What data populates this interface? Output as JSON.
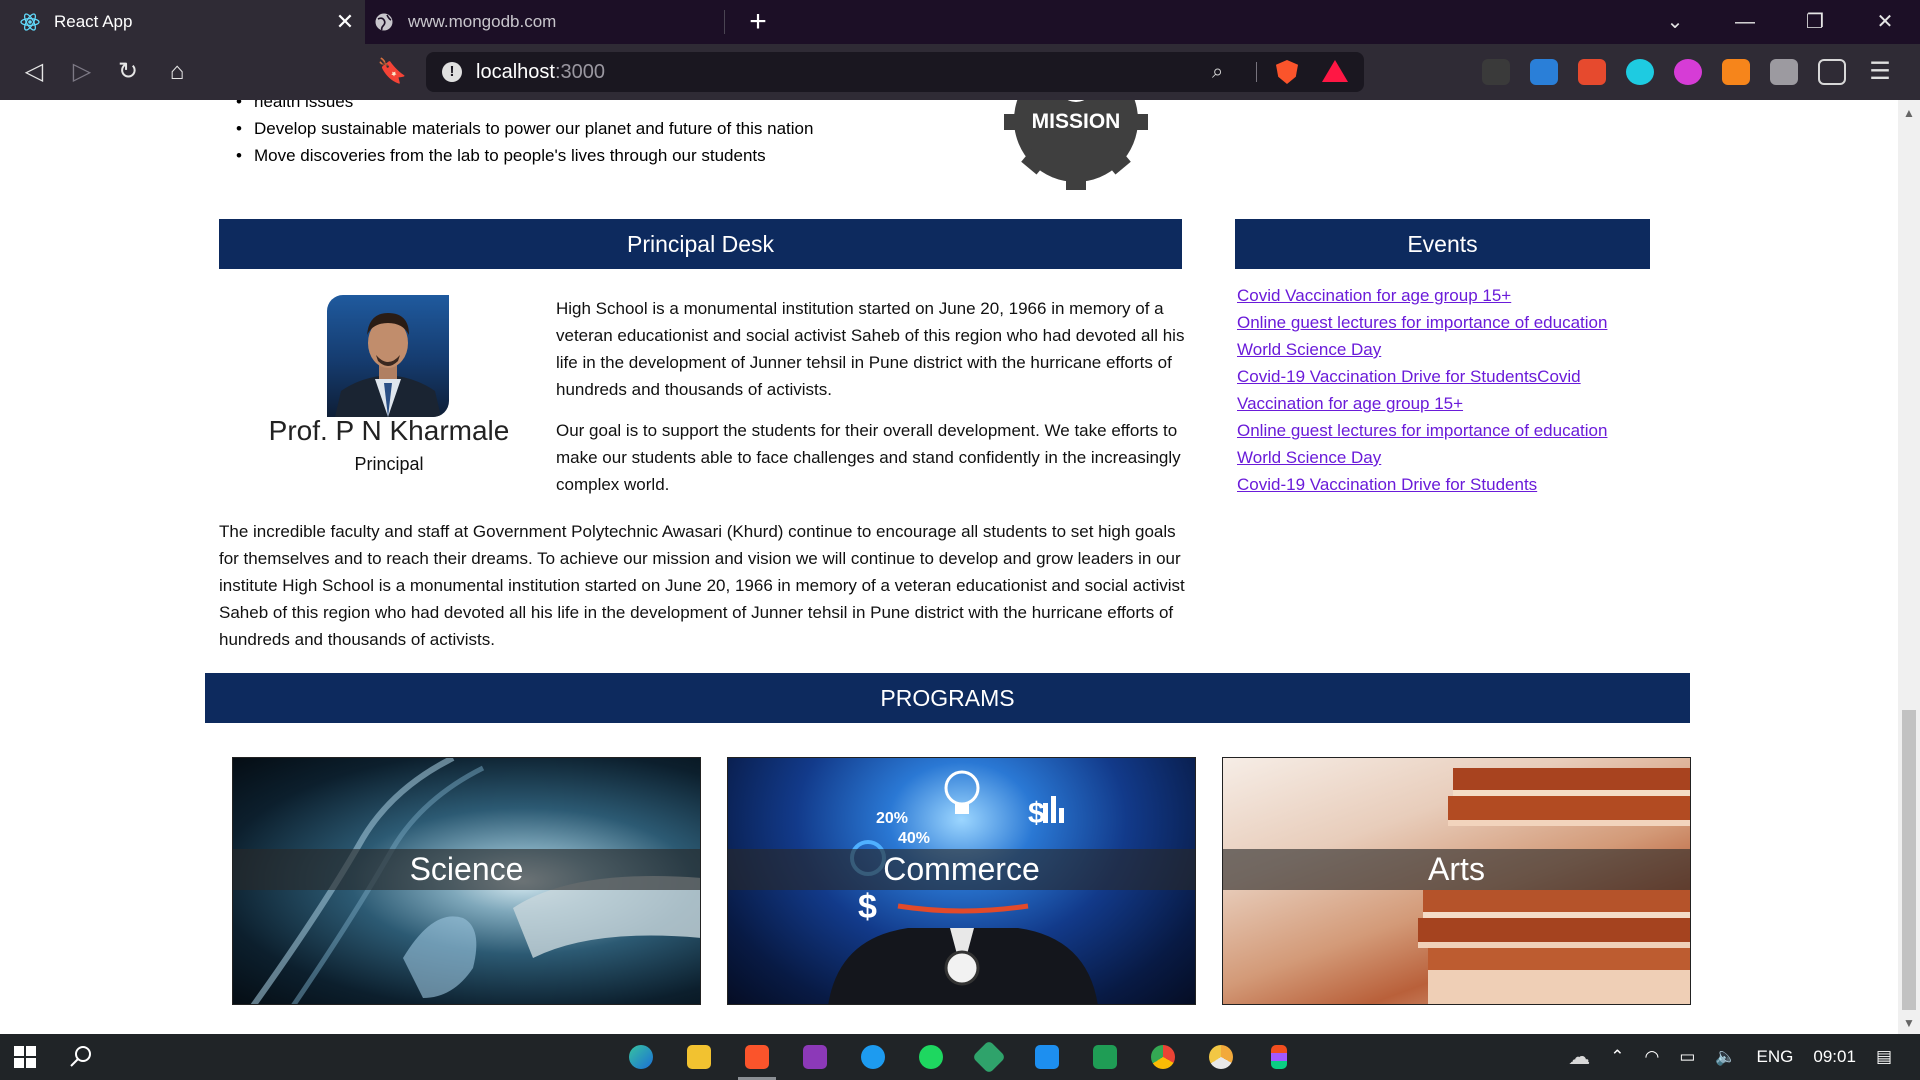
{
  "browser": {
    "active_tab_title": "React App",
    "inactive_tab_title": "www.mongodb.com",
    "address": {
      "host": "localhost",
      "port": ":3000"
    }
  },
  "mission": {
    "partial_text": "health issues",
    "items": [
      "Develop sustainable materials to power our planet and future of this nation",
      "Move discoveries from the lab to people's lives through our students"
    ],
    "badge_label": "MISSION"
  },
  "principal": {
    "heading": "Principal Desk",
    "name": "Prof. P N Kharmale",
    "role": "Principal",
    "para1": "High School is a monumental institution started on June 20, 1966 in memory of a veteran educationist and social activist Saheb of this region who had devoted all his life in the development of Junner tehsil in Pune district with the hurricane efforts of hundreds and thousands of activists.",
    "para2": "Our goal is to support the students for their overall development. We take efforts to make our students able to face challenges and stand confidently in the increasingly complex world.",
    "para3": "The incredible faculty and staff at Government Polytechnic Awasari (Khurd) continue to encourage all students to set high goals for themselves and to reach their dreams. To achieve our mission and vision we will continue to develop and grow leaders in our institute High School is a monumental institution started on June 20, 1966 in memory of a veteran educationist and social activist Saheb of this region who had devoted all his life in the development of Junner tehsil in Pune district with the hurricane efforts of hundreds and thousands of activists."
  },
  "events": {
    "heading": "Events",
    "items": [
      "Covid Vaccination for age group 15+",
      "Online guest lectures for importance of education",
      "World Science Day",
      "Covid-19 Vaccination Drive for StudentsCovid",
      "Vaccination for age group 15+",
      "Online guest lectures for importance of education",
      "World Science Day",
      "Covid-19 Vaccination Drive for Students"
    ]
  },
  "programs": {
    "heading": "PROGRAMS",
    "cards": [
      {
        "label": "Science"
      },
      {
        "label": "Commerce",
        "overlay_1": "20%",
        "overlay_2": "40%"
      },
      {
        "label": "Arts"
      }
    ]
  },
  "taskbar": {
    "language": "ENG",
    "clock": "09:01"
  },
  "colors": {
    "section_bar": "#0d2a5e",
    "link": "#6a1bd9",
    "browser_frame": "#1c0f26",
    "toolbar": "#2f2b35",
    "taskbar": "#202427"
  }
}
